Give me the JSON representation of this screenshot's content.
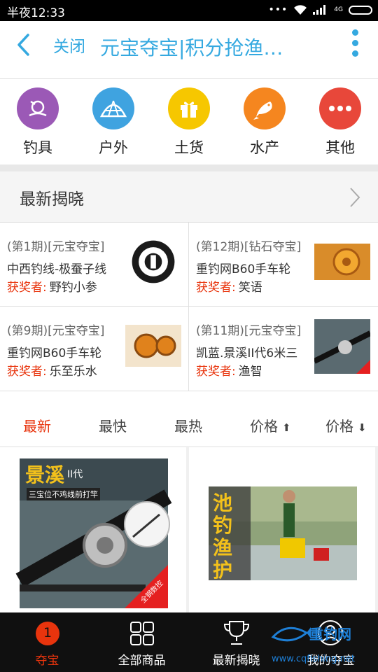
{
  "status_bar": {
    "time": "半夜12:33",
    "dots": "•••",
    "net_badge": "4G"
  },
  "header": {
    "close_label": "关闭",
    "title": "元宝夺宝|积分抢渔…"
  },
  "categories": [
    {
      "label": "钓具",
      "color": "#9b59b6",
      "icon": "fishing-reel-icon"
    },
    {
      "label": "户外",
      "color": "#3fa3e0",
      "icon": "tent-icon"
    },
    {
      "label": "土货",
      "color": "#f6c700",
      "icon": "gift-icon"
    },
    {
      "label": "水产",
      "color": "#f5861f",
      "icon": "fish-icon"
    },
    {
      "label": "其他",
      "color": "#e8473a",
      "icon": "more-icon"
    }
  ],
  "reveal": {
    "title": "最新揭晓",
    "winner_label": "获奖者:",
    "items": [
      {
        "period": "(第1期)[元宝夺宝]",
        "name": "中西钓线-极蚕子线",
        "winner": "野钓小参"
      },
      {
        "period": "(第12期)[钻石夺宝]",
        "name": "重钓网B60手车轮",
        "winner": "笑语"
      },
      {
        "period": "(第9期)[元宝夺宝]",
        "name": "重钓网B60手车轮",
        "winner": "乐至乐水"
      },
      {
        "period": "(第11期)[元宝夺宝]",
        "name": "凯蓝.景溪II代6米三",
        "winner": "渔智"
      }
    ]
  },
  "sort": {
    "newest": "最新",
    "fastest": "最快",
    "hottest": "最热",
    "price_up": "价格",
    "price_down": "价格"
  },
  "products": [
    {
      "headline": "景溪",
      "sub": "II代",
      "banner": "三宝位不鸡线前打竿",
      "badge": "全钢数控"
    },
    {
      "headline": "池钓渔护"
    }
  ],
  "tabs": [
    {
      "label": "夺宝",
      "badge": "1"
    },
    {
      "label": "全部商品"
    },
    {
      "label": "最新揭晓"
    },
    {
      "label": "我的夺宝"
    }
  ],
  "watermark": {
    "brand": "重钓网",
    "url": "www.cqfishing.net"
  },
  "colors": {
    "accent_blue": "#35a9e0",
    "accent_red": "#e8340d"
  }
}
